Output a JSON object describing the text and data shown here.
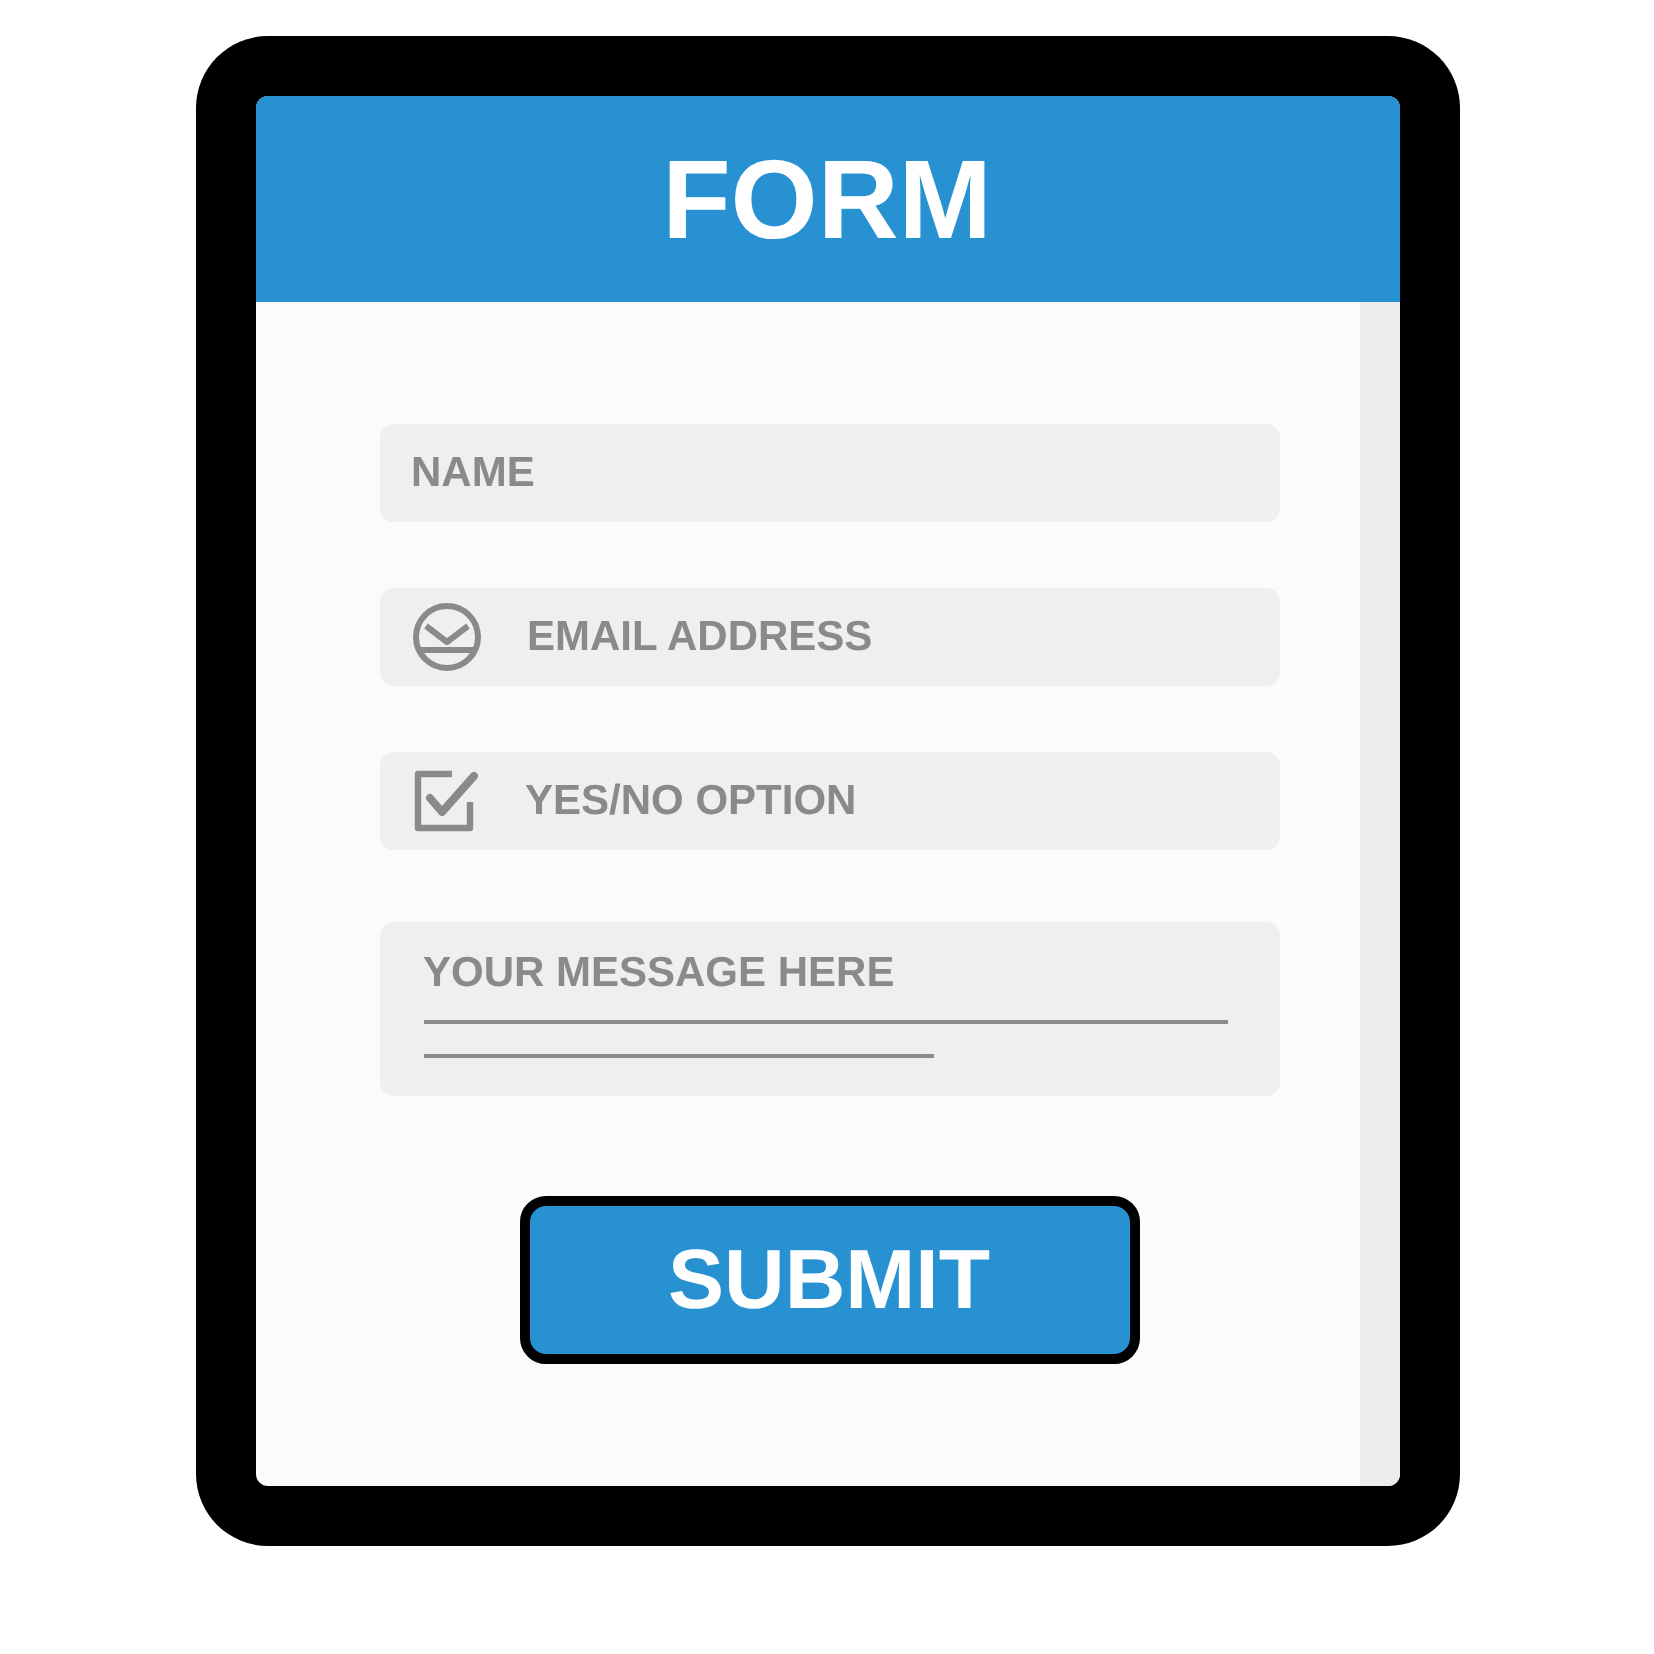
{
  "header": {
    "title": "FORM"
  },
  "fields": [
    {
      "kind": "text",
      "placeholder": "NAME"
    },
    {
      "kind": "email",
      "placeholder": "EMAIL ADDRESS"
    },
    {
      "kind": "checkbox",
      "label": "YES/NO OPTION",
      "checked": true
    },
    {
      "kind": "textarea",
      "placeholder": "YOUR MESSAGE HERE"
    }
  ],
  "submit": {
    "label": "SUBMIT"
  }
}
